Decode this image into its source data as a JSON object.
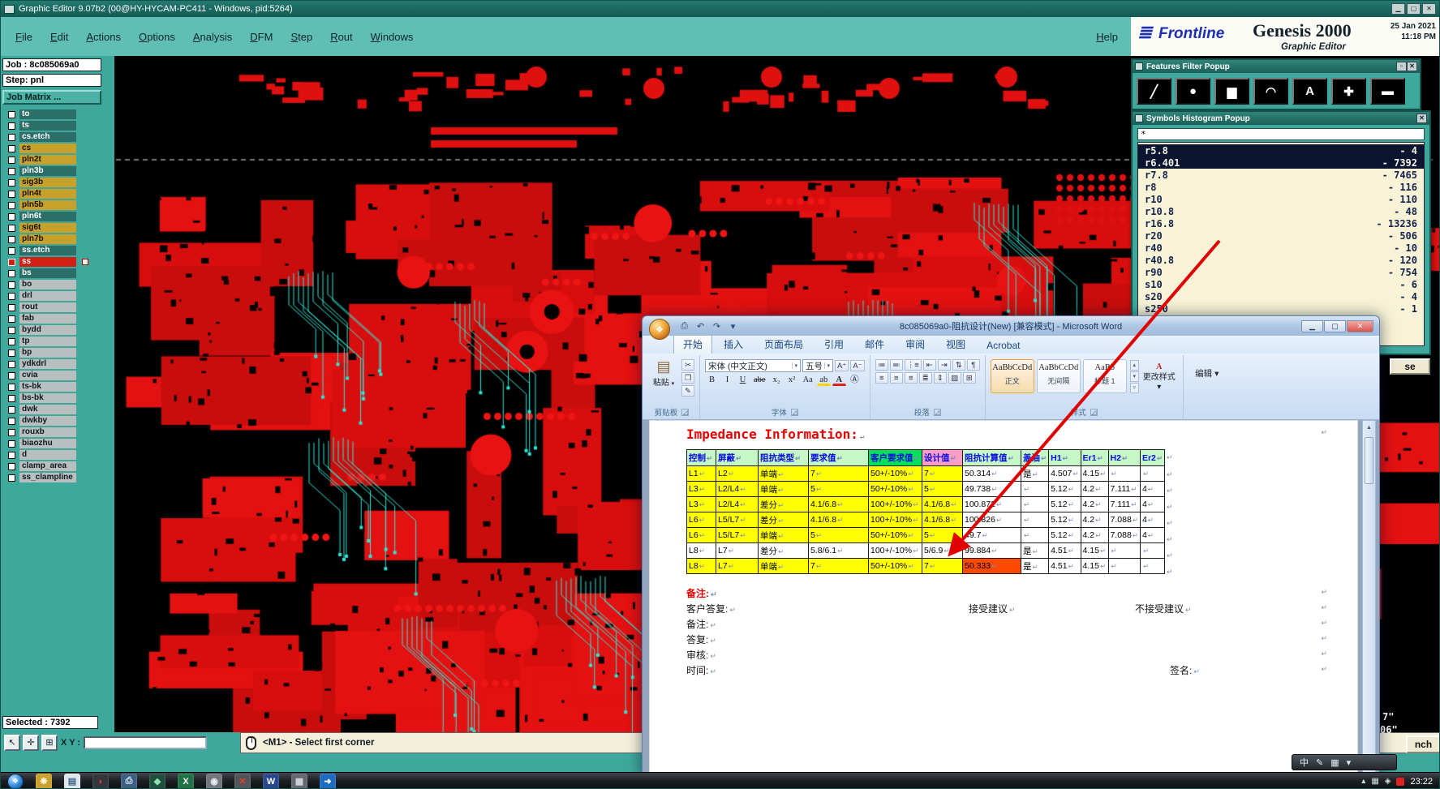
{
  "titlebar": {
    "title": "Graphic Editor 9.07b2 (00@HY-HYCAM-PC411 - Windows, pid:5264)",
    "buttons": [
      {
        "name": "minimize-button",
        "glyph": "▁"
      },
      {
        "name": "maximize-button",
        "glyph": "▢"
      },
      {
        "name": "close-button",
        "glyph": "✕"
      }
    ]
  },
  "menubar": {
    "items": [
      "File",
      "Edit",
      "Actions",
      "Options",
      "Analysis",
      "DFM",
      "Step",
      "Rout",
      "Windows"
    ],
    "help": "Help"
  },
  "brand": {
    "logo_bars": "≣",
    "frontline": "Frontline",
    "product": "Genesis 2000",
    "date": "25 Jan 2021",
    "time": "11:18 PM",
    "subtitle": "Graphic Editor"
  },
  "sidebar": {
    "job": "Job : 8c085069a0",
    "step": "Step: pnl",
    "job_matrix": "Job Matrix ...",
    "layers": [
      {
        "name": "to",
        "color": "dark"
      },
      {
        "name": "ts",
        "color": "dark"
      },
      {
        "name": "cs.etch",
        "color": "dark"
      },
      {
        "name": "cs",
        "color": "gold"
      },
      {
        "name": "pln2t",
        "color": "gold"
      },
      {
        "name": "pln3b",
        "color": "dark"
      },
      {
        "name": "sig3b",
        "color": "gold"
      },
      {
        "name": "pln4t",
        "color": "gold"
      },
      {
        "name": "pln5b",
        "color": "gold"
      },
      {
        "name": "pln6t",
        "color": "dark"
      },
      {
        "name": "sig6t",
        "color": "gold"
      },
      {
        "name": "pln7b",
        "color": "gold"
      },
      {
        "name": "ss.etch",
        "color": "dark"
      },
      {
        "name": "ss",
        "color": "red",
        "active": true
      },
      {
        "name": "bs",
        "color": "dark"
      },
      {
        "name": "bo",
        "color": "gray"
      },
      {
        "name": "drl",
        "color": "gray"
      },
      {
        "name": "rout",
        "color": "gray"
      },
      {
        "name": "fab",
        "color": "gray"
      },
      {
        "name": "bydd",
        "color": "gray"
      },
      {
        "name": "tp",
        "color": "gray"
      },
      {
        "name": "bp",
        "color": "gray"
      },
      {
        "name": "ydkdrl",
        "color": "gray"
      },
      {
        "name": "cvia",
        "color": "gray"
      },
      {
        "name": "ts-bk",
        "color": "gray"
      },
      {
        "name": "bs-bk",
        "color": "gray"
      },
      {
        "name": "dwk",
        "color": "gray"
      },
      {
        "name": "dwkby",
        "color": "gray"
      },
      {
        "name": "rouxb",
        "color": "gray"
      },
      {
        "name": "biaozhu",
        "color": "gray"
      },
      {
        "name": "d",
        "color": "gray"
      },
      {
        "name": "clamp_area",
        "color": "gray"
      },
      {
        "name": "ss_clampline",
        "color": "gray"
      }
    ],
    "selected": "Selected : 7392",
    "xy_label": "X Y :",
    "tools": [
      {
        "name": "pointer-tool-button",
        "glyph": "↖"
      },
      {
        "name": "crosshair-tool-button",
        "glyph": "✛"
      },
      {
        "name": "grid-tool-button",
        "glyph": "⊞"
      }
    ]
  },
  "status": {
    "message": "<M1> - Select first corner"
  },
  "features_popup": {
    "title": "Features Filter Popup",
    "buttons": [
      {
        "name": "popup-shade-button",
        "glyph": "▫"
      },
      {
        "name": "popup-close-button",
        "glyph": "✕"
      }
    ],
    "tools": [
      {
        "name": "line-filter-button",
        "glyph": "╱"
      },
      {
        "name": "pad-filter-button",
        "glyph": "●"
      },
      {
        "name": "surface-filter-button",
        "glyph": "▆"
      },
      {
        "name": "arc-filter-button",
        "glyph": "◠"
      },
      {
        "name": "text-filter-button",
        "glyph": "A"
      },
      {
        "name": "positive-filter-button",
        "glyph": "✚"
      },
      {
        "name": "negative-filter-button",
        "glyph": "▬"
      }
    ]
  },
  "histogram_popup": {
    "title": "Symbols Histogram Popup",
    "buttons": [
      {
        "name": "popup-close-button",
        "glyph": "✕"
      }
    ],
    "filter": "*",
    "rows": [
      {
        "name": "r5.8",
        "count": "4",
        "selected": true
      },
      {
        "name": "r6.401",
        "count": "7392",
        "selected": true
      },
      {
        "name": "r7.8",
        "count": "7465"
      },
      {
        "name": "r8",
        "count": "116"
      },
      {
        "name": "r10",
        "count": "110"
      },
      {
        "name": "r10.8",
        "count": "48"
      },
      {
        "name": "r16.8",
        "count": "13236"
      },
      {
        "name": "r20",
        "count": "506"
      },
      {
        "name": "r40",
        "count": "10"
      },
      {
        "name": "r40.8",
        "count": "120"
      },
      {
        "name": "r90",
        "count": "754"
      },
      {
        "name": "s10",
        "count": "6"
      },
      {
        "name": "s20",
        "count": "4"
      },
      {
        "name": "s250",
        "count": "1"
      }
    ]
  },
  "fragments": {
    "close_partial": "se",
    "coord_top": "7\"",
    "coord_bottom": "06\"",
    "inch_partial": "nch"
  },
  "word": {
    "title": "8c085069a0-阻抗设计(New) [兼容模式] - Microsoft Word",
    "orb_glyph": "❖",
    "qat": [
      {
        "name": "save-icon",
        "glyph": "⎙"
      },
      {
        "name": "undo-icon",
        "glyph": "↶"
      },
      {
        "name": "redo-icon",
        "glyph": "↷"
      },
      {
        "name": "qat-more-icon",
        "glyph": "▾"
      }
    ],
    "window_buttons": [
      {
        "name": "word-minimize-button",
        "glyph": "▁"
      },
      {
        "name": "word-maximize-button",
        "glyph": "▢"
      },
      {
        "name": "word-close-button",
        "glyph": "✕"
      }
    ],
    "tabs": [
      {
        "label": "开始",
        "active": true
      },
      {
        "label": "插入",
        "active": false
      },
      {
        "label": "页面布局",
        "active": false
      },
      {
        "label": "引用",
        "active": false
      },
      {
        "label": "邮件",
        "active": false
      },
      {
        "label": "审阅",
        "active": false
      },
      {
        "label": "视图",
        "active": false
      },
      {
        "label": "Acrobat",
        "active": false
      }
    ],
    "ribbon": {
      "paste": "粘贴",
      "combo_arrow": "▾",
      "dialog_launcher": "◿",
      "clipboard_icon": "▤",
      "clipboard_small": [
        {
          "name": "cut-icon",
          "glyph": "✂"
        },
        {
          "name": "copy-icon",
          "glyph": "❐"
        },
        {
          "name": "format-painter-icon",
          "glyph": "✎"
        }
      ],
      "font_name": "宋体 (中文正文)",
      "font_size": "五号",
      "font_row1_buttons": [
        {
          "name": "grow-font-icon",
          "glyph": "A⁺"
        },
        {
          "name": "shrink-font-icon",
          "glyph": "A⁻"
        }
      ],
      "font_buttons": [
        {
          "name": "bold-icon",
          "glyph": "B"
        },
        {
          "name": "italic-icon",
          "glyph": "I"
        },
        {
          "name": "underline-icon",
          "glyph": "U"
        },
        {
          "name": "strikethrough-icon",
          "glyph": "abe"
        },
        {
          "name": "subscript-icon",
          "glyph": "x₂"
        },
        {
          "name": "superscript-icon",
          "glyph": "x²"
        },
        {
          "name": "change-case-icon",
          "glyph": "Aa"
        },
        {
          "name": "highlight-icon",
          "glyph": "ab"
        },
        {
          "name": "font-color-icon",
          "glyph": "A"
        },
        {
          "name": "character-border-icon",
          "glyph": "Ⓐ"
        }
      ],
      "para_row1": [
        {
          "name": "bullets-icon",
          "glyph": "≔"
        },
        {
          "name": "numbering-icon",
          "glyph": "≕"
        },
        {
          "name": "multilevel-list-icon",
          "glyph": "⋮≡"
        },
        {
          "name": "decrease-indent-icon",
          "glyph": "⇤"
        },
        {
          "name": "increase-indent-icon",
          "glyph": "⇥"
        },
        {
          "name": "sort-icon",
          "glyph": "⇅"
        },
        {
          "name": "pilcrow-icon",
          "glyph": "¶"
        }
      ],
      "para_row2": [
        {
          "name": "align-left-icon",
          "glyph": "≡"
        },
        {
          "name": "align-center-icon",
          "glyph": "≡"
        },
        {
          "name": "align-right-icon",
          "glyph": "≡"
        },
        {
          "name": "justify-icon",
          "glyph": "≣"
        },
        {
          "name": "line-spacing-icon",
          "glyph": "⇕"
        },
        {
          "name": "shading-icon",
          "glyph": "▨"
        },
        {
          "name": "borders-icon",
          "glyph": "⊞"
        }
      ],
      "groups": {
        "clipboard": "剪贴板",
        "font": "字体",
        "paragraph": "段落",
        "styles": "样式"
      },
      "styles": [
        {
          "preview": "AaBbCcDd",
          "label": "正文",
          "active": true
        },
        {
          "preview": "AaBbCcDd",
          "label": "无间隔",
          "active": false
        },
        {
          "preview": "AaBb",
          "label": "标题 1",
          "active": false
        }
      ],
      "gallery_scroll": [
        {
          "name": "gallery-up-icon",
          "glyph": "▴"
        },
        {
          "name": "gallery-down-icon",
          "glyph": "▾"
        },
        {
          "name": "gallery-more-icon",
          "glyph": "▿"
        }
      ],
      "change_styles_icon": "A",
      "change_styles": "更改样式",
      "editing": "编辑"
    },
    "scrollbar": {
      "up": "▲",
      "down": "▼"
    },
    "doc": {
      "heading": "Impedance Information:",
      "pilcrow": "↵",
      "table": {
        "headers": [
          [
            "控制",
            "g"
          ],
          [
            "屏蔽",
            "g"
          ],
          [
            "阻抗类型",
            "g"
          ],
          [
            "要求值",
            "g"
          ],
          [
            "客户要求值",
            "G"
          ],
          [
            "设计值",
            "p"
          ],
          [
            "阻抗计算值",
            "g"
          ],
          [
            "盖油",
            "g"
          ],
          [
            "H1",
            "g"
          ],
          [
            "Er1",
            "g"
          ],
          [
            "H2",
            "g"
          ],
          [
            "Er2",
            "g"
          ]
        ],
        "rows": [
          [
            [
              "L1",
              "y"
            ],
            [
              "L2",
              "y"
            ],
            [
              "单端",
              "y"
            ],
            [
              "7",
              "y"
            ],
            [
              "50+/-10%",
              "y"
            ],
            [
              "7",
              "y"
            ],
            [
              "50.314",
              ""
            ],
            [
              "是",
              ""
            ],
            [
              "4.507",
              ""
            ],
            [
              "4.15",
              ""
            ],
            [
              "",
              ""
            ],
            [
              "",
              ""
            ]
          ],
          [
            [
              "L3",
              "y"
            ],
            [
              "L2/L4",
              "y"
            ],
            [
              "单端",
              "y"
            ],
            [
              "5",
              "y"
            ],
            [
              "50+/-10%",
              "y"
            ],
            [
              "5",
              "y"
            ],
            [
              "49.738",
              ""
            ],
            [
              "",
              ""
            ],
            [
              "5.12",
              ""
            ],
            [
              "4.2",
              ""
            ],
            [
              "7.111",
              ""
            ],
            [
              "4",
              ""
            ]
          ],
          [
            [
              "L3",
              "y"
            ],
            [
              "L2/L4",
              "y"
            ],
            [
              "差分",
              "y"
            ],
            [
              "4.1/6.8",
              "y"
            ],
            [
              "100+/-10%",
              "y"
            ],
            [
              "4.1/6.8",
              "y"
            ],
            [
              "100.872",
              ""
            ],
            [
              "",
              ""
            ],
            [
              "5.12",
              ""
            ],
            [
              "4.2",
              ""
            ],
            [
              "7.111",
              ""
            ],
            [
              "4",
              ""
            ]
          ],
          [
            [
              "L6",
              "y"
            ],
            [
              "L5/L7",
              "y"
            ],
            [
              "差分",
              "y"
            ],
            [
              "4.1/6.8",
              "y"
            ],
            [
              "100+/-10%",
              "y"
            ],
            [
              "4.1/6.8",
              "y"
            ],
            [
              "100.826",
              ""
            ],
            [
              "",
              ""
            ],
            [
              "5.12",
              ""
            ],
            [
              "4.2",
              ""
            ],
            [
              "7.088",
              ""
            ],
            [
              "4",
              ""
            ]
          ],
          [
            [
              "L6",
              "y"
            ],
            [
              "L5/L7",
              "y"
            ],
            [
              "单端",
              "y"
            ],
            [
              "5",
              "y"
            ],
            [
              "50+/-10%",
              "y"
            ],
            [
              "5",
              "y"
            ],
            [
              "49.7",
              ""
            ],
            [
              "",
              ""
            ],
            [
              "5.12",
              ""
            ],
            [
              "4.2",
              ""
            ],
            [
              "7.088",
              ""
            ],
            [
              "4",
              ""
            ]
          ],
          [
            [
              "L8",
              ""
            ],
            [
              "L7",
              ""
            ],
            [
              "差分",
              ""
            ],
            [
              "5.8/6.1",
              ""
            ],
            [
              "100+/-10%",
              ""
            ],
            [
              "5/6.9",
              ""
            ],
            [
              "99.884",
              ""
            ],
            [
              "是",
              ""
            ],
            [
              "4.51",
              ""
            ],
            [
              "4.15",
              ""
            ],
            [
              "",
              ""
            ],
            [
              "",
              ""
            ]
          ],
          [
            [
              "L8",
              "y"
            ],
            [
              "L7",
              "y"
            ],
            [
              "单端",
              "y"
            ],
            [
              "7",
              "y"
            ],
            [
              "50+/-10%",
              "y"
            ],
            [
              "7",
              "y"
            ],
            [
              "50.333",
              "r"
            ],
            [
              "是",
              ""
            ],
            [
              "4.51",
              ""
            ],
            [
              "4.15",
              ""
            ],
            [
              "",
              ""
            ],
            [
              "",
              ""
            ]
          ]
        ]
      },
      "remark1": "备注:",
      "reply_label": "客户答复:",
      "accept": "接受建议",
      "reject": "不接受建议",
      "remark2": "备注:",
      "reply2": "答复:",
      "review": "审核:",
      "time_label": "时间:",
      "sign_label": "签名:"
    }
  },
  "taskbar": {
    "start_glyph": "❖",
    "icons": [
      {
        "name": "taskbar-icon-gallery",
        "glyph": "❋",
        "bg": "#caa12c",
        "fg": "#fff8e0"
      },
      {
        "name": "taskbar-icon-notepad",
        "glyph": "▤",
        "bg": "#dfe6ec",
        "fg": "#3f6286"
      },
      {
        "name": "taskbar-icon-reader",
        "glyph": "◗",
        "bg": "#33363a",
        "fg": "#e8402f"
      },
      {
        "name": "taskbar-icon-save",
        "glyph": "⎙",
        "bg": "#3c5e80",
        "fg": "#dbe8f4"
      },
      {
        "name": "taskbar-icon-viewer",
        "glyph": "◆",
        "bg": "#1f4e3c",
        "fg": "#8fe0b0"
      },
      {
        "name": "taskbar-icon-excel",
        "glyph": "X",
        "bg": "#1f7244",
        "fg": "#ffffff"
      },
      {
        "name": "taskbar-icon-camera",
        "glyph": "◉",
        "bg": "#70767c",
        "fg": "#e8ecf0"
      },
      {
        "name": "taskbar-icon-close",
        "glyph": "✕",
        "bg": "#50555a",
        "fg": "#e8402f"
      },
      {
        "name": "taskbar-icon-word",
        "glyph": "W",
        "bg": "#28468e",
        "fg": "#ffffff"
      },
      {
        "name": "taskbar-icon-tools",
        "glyph": "▩",
        "bg": "#62686e",
        "fg": "#d2d8de"
      },
      {
        "name": "taskbar-icon-launcher",
        "glyph": "➜",
        "bg": "#1d6cc0",
        "fg": "#ffffff"
      }
    ],
    "tray": [
      {
        "name": "tray-show-hidden-icon",
        "glyph": "▴"
      },
      {
        "name": "tray-network-icon",
        "glyph": "▦"
      },
      {
        "name": "tray-volume-icon",
        "glyph": "◈"
      }
    ],
    "ime": [
      {
        "name": "ime-language-indicator",
        "glyph": "中"
      },
      {
        "name": "ime-pen-icon",
        "glyph": "✎"
      },
      {
        "name": "ime-keyboard-icon",
        "glyph": "▦"
      },
      {
        "name": "ime-options-icon",
        "glyph": "▾"
      }
    ],
    "time": "23:22"
  }
}
